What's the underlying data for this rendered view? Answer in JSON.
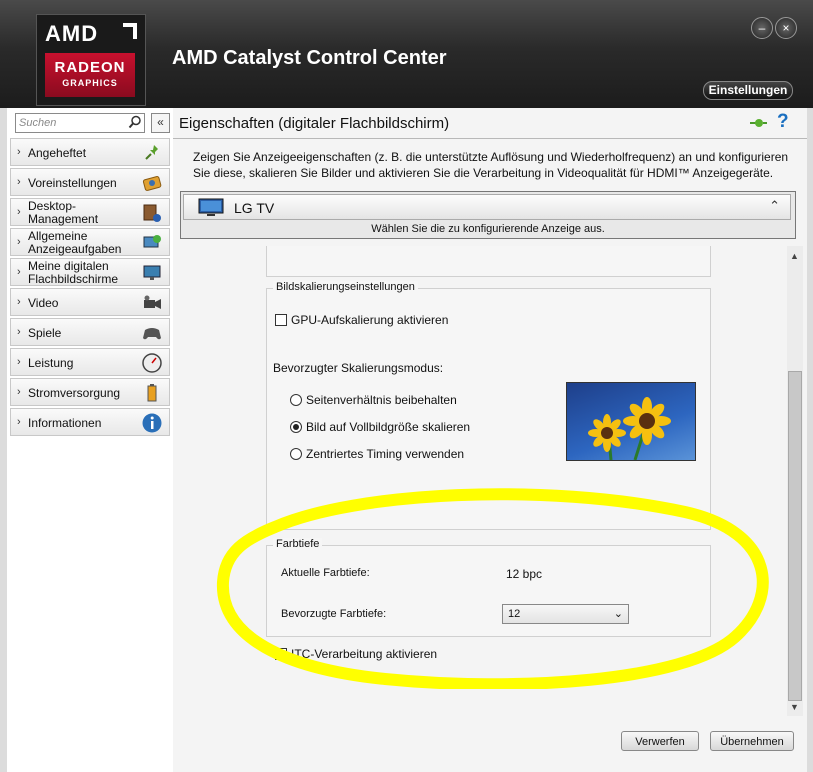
{
  "app": {
    "title": "AMD Catalyst Control Center",
    "logo_top": "AMD",
    "logo_brand": "RADEON",
    "logo_sub": "GRAPHICS",
    "settings_label": "Einstellungen",
    "minimize_glyph": "–",
    "close_glyph": "×"
  },
  "sidebar": {
    "search_placeholder": "Suchen",
    "collapse_glyph": "«",
    "items": [
      {
        "label": "Angeheftet",
        "icon": "pin-icon"
      },
      {
        "label": "Voreinstellungen",
        "icon": "presets-icon"
      },
      {
        "label": "Desktop-Management",
        "line1": "Desktop-",
        "line2": "Management",
        "icon": "desktop-icon"
      },
      {
        "label": "Allgemeine Anzeigeaufgaben",
        "line1": "Allgemeine",
        "line2": "Anzeigeaufgaben",
        "icon": "display-tasks-icon"
      },
      {
        "label": "Meine digitalen Flachbildschirme",
        "line1": "Meine digitalen",
        "line2": "Flachbildschirme",
        "icon": "flatpanel-icon"
      },
      {
        "label": "Video",
        "icon": "video-camera-icon"
      },
      {
        "label": "Spiele",
        "icon": "gamepad-icon"
      },
      {
        "label": "Leistung",
        "icon": "gauge-icon"
      },
      {
        "label": "Stromversorgung",
        "icon": "battery-icon"
      },
      {
        "label": "Informationen",
        "icon": "info-icon"
      }
    ]
  },
  "main": {
    "page_title": "Eigenschaften (digitaler Flachbildschirm)",
    "description": "Zeigen Sie Anzeigeeigenschaften (z. B. die unterstützte Auflösung und Wiederholfrequenz) an und konfigurieren Sie diese, skalieren Sie Bilder und aktivieren Sie die Verarbeitung in Videoqualität für HDMI™ Anzeigegeräte.",
    "display_selector": {
      "name": "LG TV",
      "hint": "Wählen Sie die zu konfigurierende Anzeige aus."
    },
    "scaling": {
      "legend": "Bildskalierungseinstellungen",
      "gpu_scaling_label": "GPU-Aufskalierung aktivieren",
      "gpu_scaling_checked": false,
      "mode_heading": "Bevorzugter Skalierungsmodus:",
      "options": [
        {
          "label": "Seitenverhältnis beibehalten",
          "selected": false
        },
        {
          "label": "Bild auf Vollbildgröße skalieren",
          "selected": true
        },
        {
          "label": "Zentriertes Timing verwenden",
          "selected": false
        }
      ]
    },
    "color_depth": {
      "legend": "Farbtiefe",
      "current_label": "Aktuelle Farbtiefe:",
      "current_value": "12 bpc",
      "preferred_label": "Bevorzugte Farbtiefe:",
      "preferred_value": "12"
    },
    "itc_label": "ITC-Verarbeitung aktivieren",
    "itc_checked": false
  },
  "footer": {
    "discard_label": "Verwerfen",
    "apply_label": "Übernehmen"
  },
  "colors": {
    "highlight": "#ffff00",
    "brand_red": "#c8102e",
    "help_blue": "#1a6fc0"
  }
}
